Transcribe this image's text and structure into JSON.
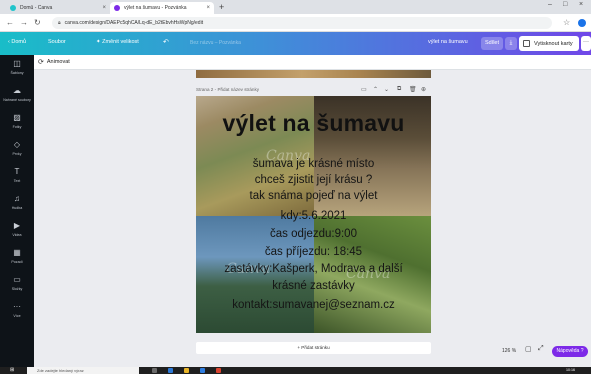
{
  "browser": {
    "tabs": [
      {
        "title": "Domů - Canva",
        "favicon_color": "#20c4cb"
      },
      {
        "title": "výlet na šumavu - Pozvánka",
        "favicon_color": "#7d2ae8"
      }
    ],
    "new_tab_icon": "plus-icon",
    "url": "canva.com/design/DAEPc5qhCA/Lq-dE_b2tEbvhHsWpNg/edit",
    "window_controls": {
      "minimize": "–",
      "maximize": "□",
      "close": "×"
    },
    "nav": {
      "back": "←",
      "forward": "→",
      "reload": "↻"
    }
  },
  "canva_header": {
    "home": "‹ Domů",
    "file": "Soubor",
    "resize": "Změnit velikost",
    "resize_prefix": "✦",
    "undo_icon": "undo-icon",
    "design_title_placeholder": "Bez názvu – Pozvánka",
    "design_name": "výlet na šumavu",
    "share": "Sdílet",
    "download_icon": "⤓",
    "print": "Vytisknout karty",
    "more": "···"
  },
  "sidebar": {
    "items": [
      {
        "icon": "templates-icon",
        "glyph": "◫",
        "label": "Šablony"
      },
      {
        "icon": "upload-icon",
        "glyph": "☁",
        "label": "Nahrané soubory"
      },
      {
        "icon": "photos-icon",
        "glyph": "▨",
        "label": "Fotky"
      },
      {
        "icon": "elements-icon",
        "glyph": "◇",
        "label": "Prvky"
      },
      {
        "icon": "text-icon",
        "glyph": "T",
        "label": "Text"
      },
      {
        "icon": "music-icon",
        "glyph": "♫",
        "label": "Hudba"
      },
      {
        "icon": "video-icon",
        "glyph": "▶",
        "label": "Videa"
      },
      {
        "icon": "background-icon",
        "glyph": "▦",
        "label": "Pozadí"
      },
      {
        "icon": "folder-icon",
        "glyph": "▭",
        "label": "Složky"
      },
      {
        "icon": "more-icon",
        "glyph": "···",
        "label": "Více"
      }
    ]
  },
  "toolbar": {
    "animate": "Animovat"
  },
  "page": {
    "label": "Strana 2 - Přidat název stránky",
    "title": "výlet na šumavu",
    "lines": [
      "šumava je krásné místo",
      "chceš zjistit její krásu ?",
      "tak snáma pojeď na výlet",
      "kdy:5.6.2021",
      "čas odjezdu:9:00",
      "čas příjezdu: 18:45",
      "zastávky:Kašperk, Modrava a další",
      "krásné zastávky",
      "kontakt:sumavanej@seznam.cz"
    ],
    "watermark": "Canva",
    "page_icons": [
      "comment-icon",
      "chevron-up-icon",
      "chevron-down-icon",
      "copy-icon",
      "trash-icon",
      "add-page-icon"
    ]
  },
  "add_page": "+ Přidat stránku",
  "footer": {
    "zoom": "126 %",
    "page_view_icon": "▢",
    "fullscreen_icon": "⤢",
    "help": "Nápověda ?"
  },
  "taskbar": {
    "search_placeholder": "Zde zadejte hledaný výraz",
    "clock": "10:16"
  }
}
